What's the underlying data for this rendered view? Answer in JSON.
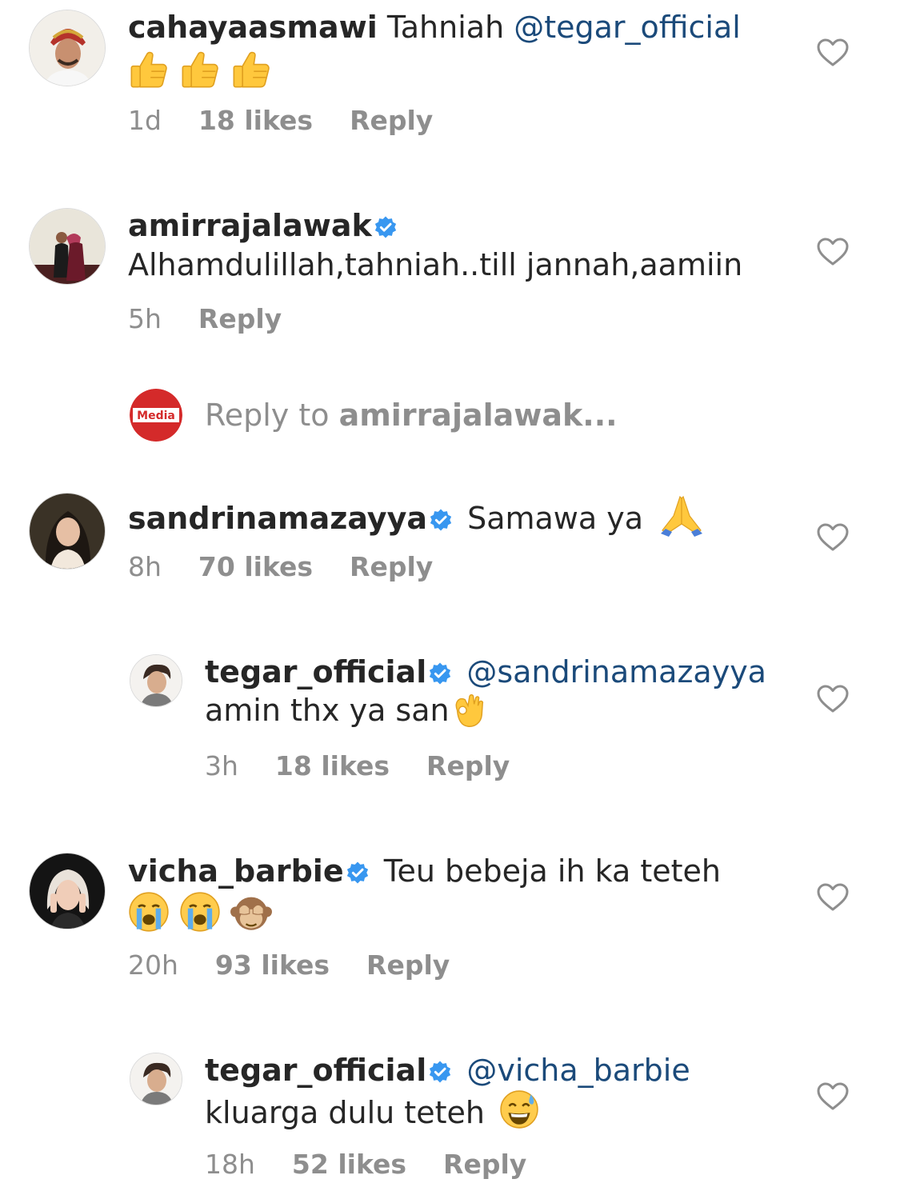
{
  "comments": [
    {
      "username": "cahayaasmawi",
      "text_before": "Tahniah ",
      "mention": "@tegar_official",
      "time": "1d",
      "likes": "18 likes",
      "reply": "Reply"
    },
    {
      "username": "amirrajalawak",
      "text": "Alhamdulillah,tahniah..till jannah,aamiin",
      "time": "5h",
      "reply": "Reply"
    },
    {
      "username": "sandrinamazayya",
      "text": "Samawa ya",
      "time": "8h",
      "likes": "70 likes",
      "reply": "Reply"
    },
    {
      "username": "tegar_official",
      "mention": "@sandrinamazayya",
      "text": "amin thx ya san",
      "time": "3h",
      "likes": "18 likes",
      "reply": "Reply"
    },
    {
      "username": "vicha_barbie",
      "text": "Teu bebeja ih ka teteh",
      "time": "20h",
      "likes": "93 likes",
      "reply": "Reply"
    },
    {
      "username": "tegar_official",
      "mention": "@vicha_barbie",
      "text": "kluarga dulu teteh",
      "time": "18h",
      "likes": "52 likes",
      "reply": "Reply"
    }
  ],
  "reply_box": {
    "prefix": "Reply to ",
    "target": "amirrajalawak...",
    "avatar_text": "Media"
  },
  "colors": {
    "mention": "#1b4a7a",
    "meta": "#8e8e8e",
    "verified": "#3897f0",
    "media_red": "#d42a2a"
  }
}
